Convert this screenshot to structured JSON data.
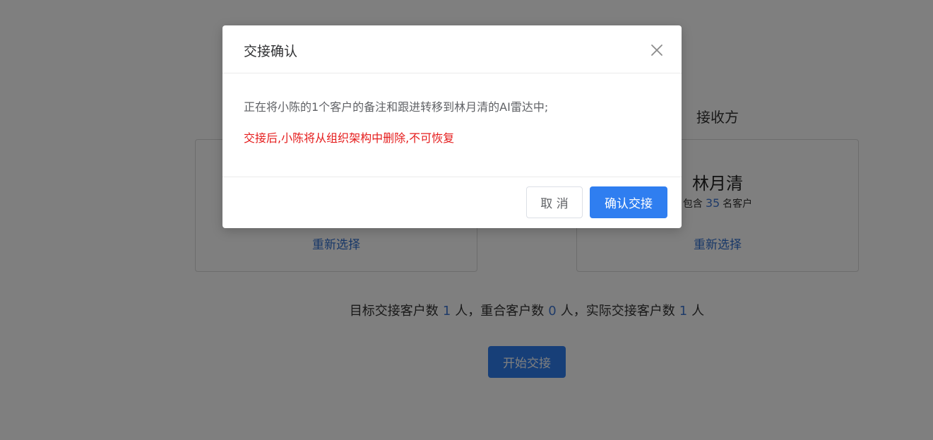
{
  "background": {
    "receiver_title": "接收方",
    "left_card": {
      "reselect": "重新选择"
    },
    "right_card": {
      "name": "林月清",
      "prefix": "包含",
      "count": "35",
      "suffix": "名客户",
      "reselect": "重新选择"
    },
    "stats": {
      "target_label": "目标交接客户数",
      "target_value": "1",
      "overlap_label": "人，重合客户数",
      "overlap_value": "0",
      "actual_label": "人，实际交接客户数",
      "actual_value": "1",
      "unit": "人"
    },
    "start_button": "开始交接"
  },
  "modal": {
    "title": "交接确认",
    "close_icon": "close-icon",
    "message": "正在将小陈的1个客户的备注和跟进转移到林月清的AI雷达中;",
    "warning": "交接后,小陈将从组织架构中删除,不可恢复",
    "cancel_label": "取 消",
    "confirm_label": "确认交接"
  },
  "colors": {
    "primary": "#2f7ef0",
    "warning": "#e51c1c",
    "link": "#2f6fd1"
  }
}
